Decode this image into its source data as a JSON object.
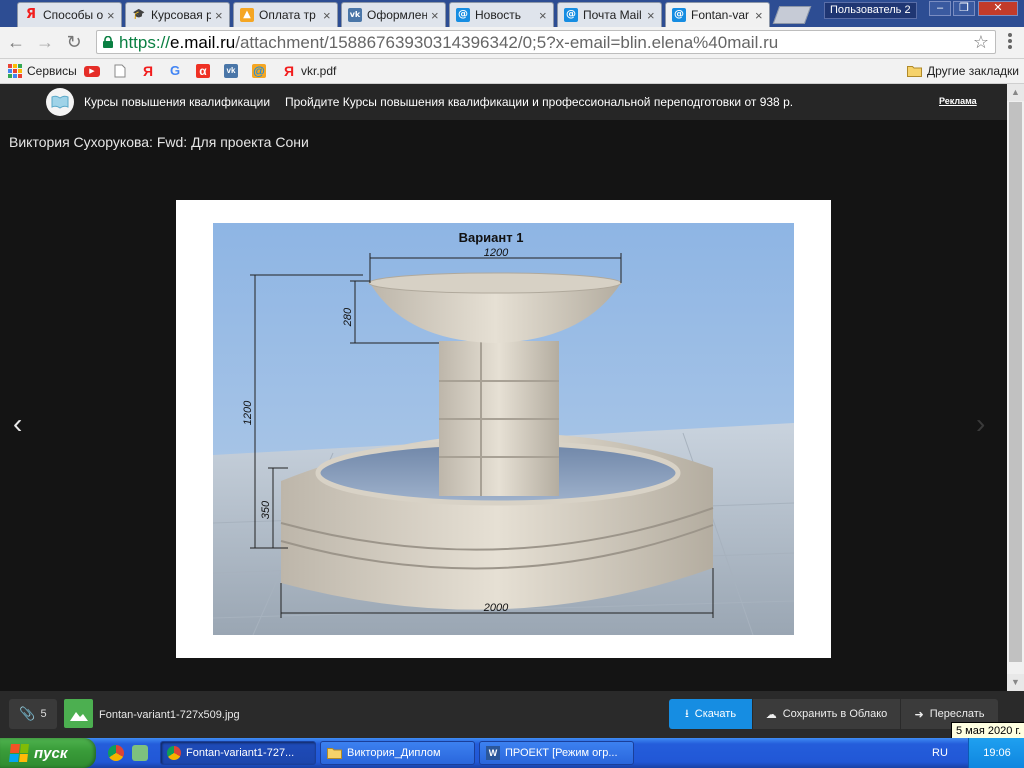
{
  "browser": {
    "tabs": [
      {
        "title": "Способы ок",
        "icon": "yandex-icon",
        "color": "#f21d1d",
        "glyph": "Я",
        "active": false
      },
      {
        "title": "Курсовая р",
        "icon": "graduation-cap-icon",
        "color": "#000000",
        "glyph": "🎓",
        "active": false
      },
      {
        "title": "Оплата тр",
        "icon": "thumbs-up-icon",
        "color": "#f5a623",
        "glyph": "👍",
        "active": false
      },
      {
        "title": "Оформлен",
        "icon": "vk-icon",
        "color": "#4a76a8",
        "glyph": "vk",
        "active": false
      },
      {
        "title": "Новость",
        "icon": "mail-at-icon",
        "color": "#168de2",
        "glyph": "@",
        "active": false
      },
      {
        "title": "Почта Mail",
        "icon": "mail-at-icon",
        "color": "#168de2",
        "glyph": "@",
        "active": false
      },
      {
        "title": "Fontan-var",
        "icon": "mail-at-icon",
        "color": "#168de2",
        "glyph": "@",
        "active": true
      }
    ],
    "user_badge": "Пользователь 2",
    "url": {
      "scheme": "https://",
      "host": "e.mail.ru",
      "path": "/attachment/15886763930314396342/0;5?x-email=blin.elena%40mail.ru"
    },
    "bookmarks": [
      {
        "label": "Сервисы",
        "icon": "apps-grid-icon"
      },
      {
        "label": "",
        "icon": "youtube-icon"
      },
      {
        "label": "",
        "icon": "page-icon"
      },
      {
        "label": "",
        "icon": "yandex-icon"
      },
      {
        "label": "",
        "icon": "google-icon"
      },
      {
        "label": "",
        "icon": "alpha-icon"
      },
      {
        "label": "",
        "icon": "vk-icon"
      },
      {
        "label": "",
        "icon": "mail-at-icon"
      },
      {
        "label": "vkr.pdf",
        "icon": "yandex-icon"
      }
    ],
    "other_bookmarks": "Другие закладки"
  },
  "ad": {
    "title": "Курсы повышения квалификации",
    "text": "Пройдите Курсы повышения квалификации и профессиональной переподготовки от 938 р.",
    "label": "Реклама"
  },
  "viewer": {
    "letter_title": "Виктория Сухорукова: Fwd: Для проекта Сони",
    "image": {
      "heading": "Вариант 1",
      "dim_bowl_width": "1200",
      "dim_bowl_height": "280",
      "dim_total_height": "1200",
      "dim_base_height": "350",
      "dim_base_width": "2000"
    }
  },
  "bottom": {
    "attachments_count": "5",
    "file_name": "Fontan-variant1-727x509.jpg",
    "download": "Скачать",
    "save_cloud": "Сохранить в Облако",
    "forward": "Переслать"
  },
  "taskbar": {
    "start": "пуск",
    "tasks": [
      {
        "label": "Fontan-variant1-727...",
        "icon": "chrome-icon",
        "active": true
      },
      {
        "label": "Виктория_Диплом",
        "icon": "folder-icon",
        "active": false
      },
      {
        "label": "ПРОЕКТ [Режим огр...",
        "icon": "word-icon",
        "active": false
      }
    ],
    "lang": "RU",
    "clock": "19:06",
    "date_tooltip": "5 мая 2020 г."
  }
}
